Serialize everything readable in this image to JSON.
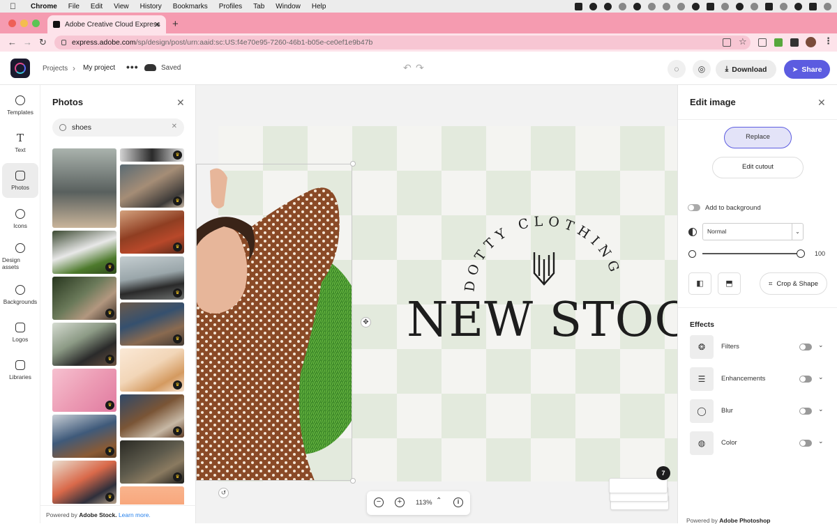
{
  "menubar": {
    "items": [
      "Chrome",
      "File",
      "Edit",
      "View",
      "History",
      "Bookmarks",
      "Profiles",
      "Tab",
      "Window",
      "Help"
    ]
  },
  "browser": {
    "tab_title": "Adobe Creative Cloud Express",
    "url_host": "express.adobe.com",
    "url_path": "/sp/design/post/urn:aaid:sc:US:f4e70e95-7260-46b1-b05e-ce0ef1e9b47b"
  },
  "header": {
    "crumb_projects": "Projects",
    "crumb_current": "My project",
    "more": "•••",
    "saved": "Saved",
    "download": "Download",
    "share": "Share"
  },
  "rail": {
    "items": [
      {
        "label": "Templates",
        "icon": "templates-icon"
      },
      {
        "label": "Text",
        "icon": "text-icon"
      },
      {
        "label": "Photos",
        "icon": "photos-icon",
        "active": true
      },
      {
        "label": "Icons",
        "icon": "icons-icon"
      },
      {
        "label": "Design assets",
        "icon": "design-assets-icon"
      },
      {
        "label": "Backgrounds",
        "icon": "backgrounds-icon"
      },
      {
        "label": "Logos",
        "icon": "logos-icon"
      },
      {
        "label": "Libraries",
        "icon": "libraries-icon"
      }
    ]
  },
  "photos": {
    "title": "Photos",
    "search_value": "shoes",
    "powered_prefix": "Powered by",
    "powered_brand": "Adobe Stock.",
    "learn_more": "Learn more."
  },
  "canvas": {
    "brand": "DOTTY CLOTHING",
    "headline": "NEW STOCK",
    "zoom": "113%",
    "page_count": "7"
  },
  "edit": {
    "title": "Edit image",
    "replace": "Replace",
    "edit_cutout": "Edit cutout",
    "add_to_background": "Add to background",
    "blend_mode": "Normal",
    "opacity": "100",
    "crop_shape": "Crop & Shape",
    "effects_title": "Effects",
    "effects": [
      {
        "label": "Filters",
        "icon": "filters-icon"
      },
      {
        "label": "Enhancements",
        "icon": "enhancements-icon"
      },
      {
        "label": "Blur",
        "icon": "blur-icon"
      },
      {
        "label": "Color",
        "icon": "color-icon"
      }
    ],
    "powered_prefix": "Powered by",
    "powered_brand": "Adobe Photoshop"
  },
  "colors": {
    "tabstrip": "#f59bb0",
    "accent": "#5c5ce0",
    "checker": "#e3eadd"
  }
}
